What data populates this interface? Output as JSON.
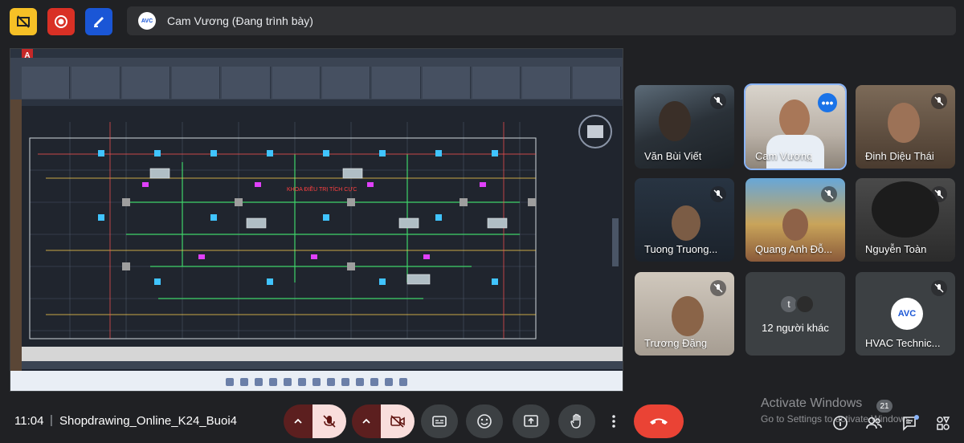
{
  "top_bar": {
    "presenter_initials": "AVC",
    "presenter_text": "Cam Vương (Đang trình bày)"
  },
  "shared_screen": {
    "drawing_label": "KHOA ĐIỀU TRỊ TÍCH CỰC",
    "compass_top": "TOP"
  },
  "participants": [
    {
      "name": "Văn Bùi Viết",
      "muted": true
    },
    {
      "name": "Cam Vương",
      "muted": false,
      "speaking": true
    },
    {
      "name": "Đinh Diệu Thái",
      "muted": true
    },
    {
      "name": "Tuong Truong...",
      "muted": true
    },
    {
      "name": "Quang Anh Đỗ...",
      "muted": true
    },
    {
      "name": "Nguyễn Toàn",
      "muted": true
    },
    {
      "name": "Trương Đặng",
      "muted": true
    },
    {
      "name": "HVAC Technic...",
      "muted": true
    }
  ],
  "others_tile": {
    "avatar_letter": "t",
    "label": "12 người khác"
  },
  "hvac_logo_text": "AVC",
  "bottom_bar": {
    "time": "11:04",
    "separator": "|",
    "meeting_title": "Shopdrawing_Online_K24_Buoi4",
    "people_count": "21"
  },
  "watermark": {
    "line1": "Activate Windows",
    "line2": "Go to Settings to activate Windows."
  },
  "colors": {
    "background": "#202124",
    "end_call": "#ea4335",
    "muted_control": "#f9dedc",
    "accent": "#8ab4f8"
  }
}
